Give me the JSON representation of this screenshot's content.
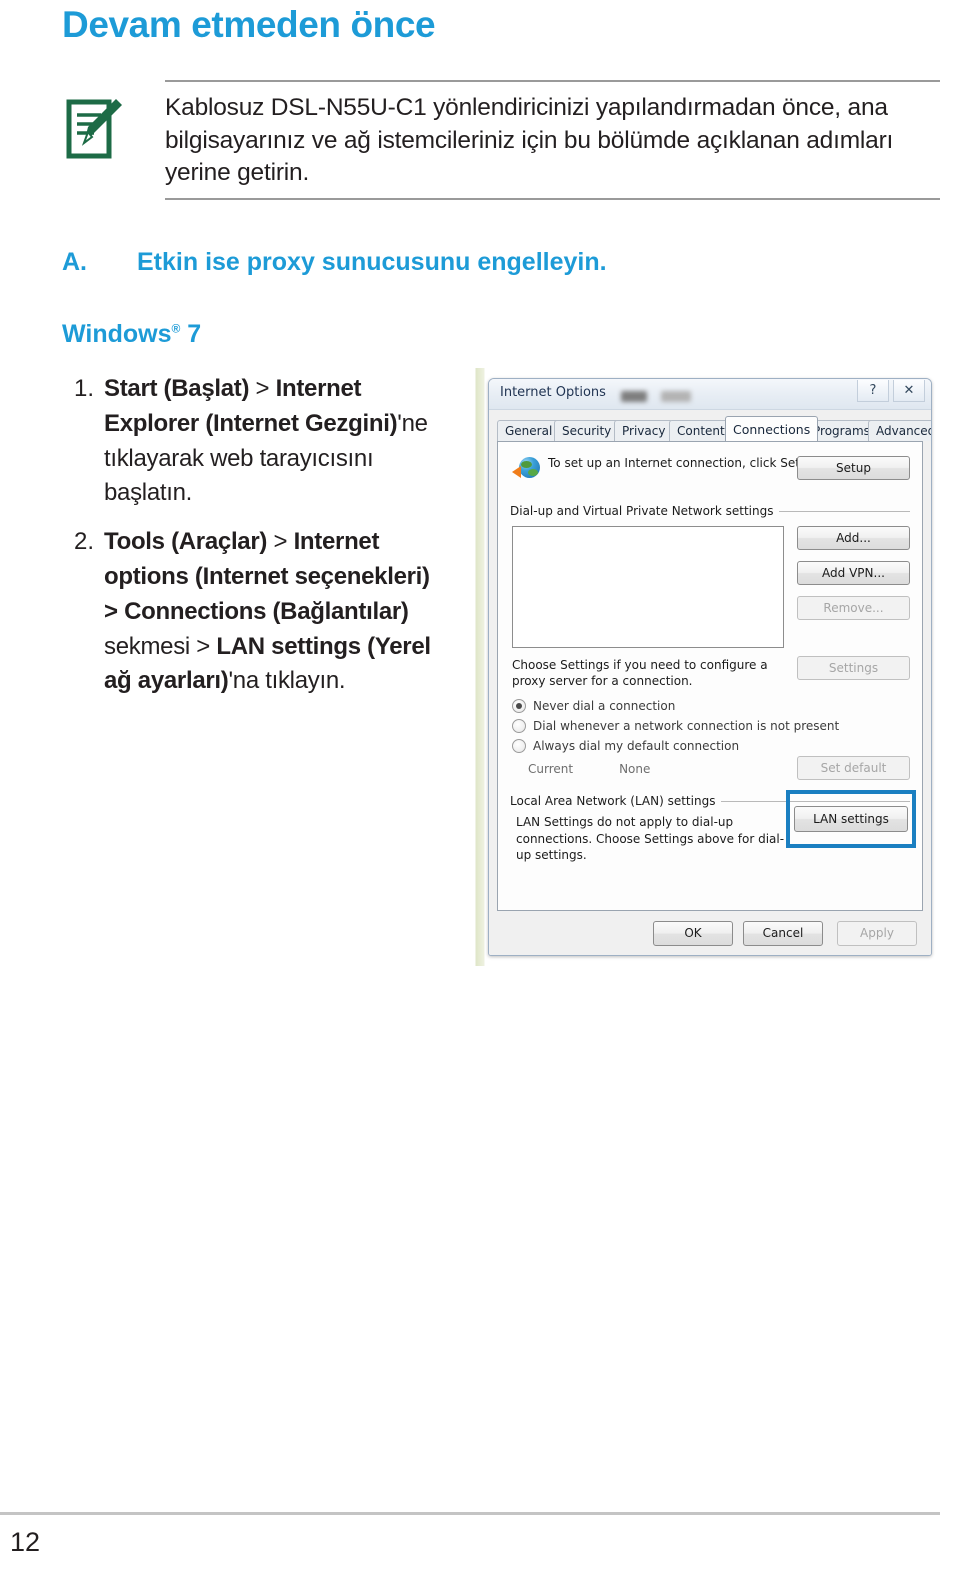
{
  "page": {
    "title": "Devam etmeden önce",
    "number": "12"
  },
  "note": {
    "icon": "note-pencil-icon",
    "text": "Kablosuz DSL-N55U-C1 yönlendiricinizi yapılandırmadan önce, ana bilgisayarınız ve ağ istemcileriniz için bu bölümde açıklanan adımları yerine getirin."
  },
  "section": {
    "letter": "A.",
    "heading": "Etkin ise proxy sunucusunu engelleyin.",
    "os_label": "Windows",
    "os_sup": "®",
    "os_version": "7"
  },
  "steps": [
    {
      "num": "1.",
      "parts": [
        {
          "text": "Start (Başlat) ",
          "bold": true
        },
        {
          "text": "> ",
          "bold": false
        },
        {
          "text": "Internet Explorer (Internet Gezgini)",
          "bold": true
        },
        {
          "text": "'ne tıklayarak web tarayıcısını başlatın.",
          "bold": false
        }
      ]
    },
    {
      "num": "2.",
      "parts": [
        {
          "text": "Tools (Araçlar) ",
          "bold": true
        },
        {
          "text": "> ",
          "bold": false
        },
        {
          "text": "Internet options (Internet seçenekleri) > Connections (Bağlantılar) ",
          "bold": true
        },
        {
          "text": "sekmesi > ",
          "bold": false
        },
        {
          "text": "LAN settings (Yerel ağ ayarları)",
          "bold": true
        },
        {
          "text": "'na tıklayın.",
          "bold": false
        }
      ]
    }
  ],
  "dialog": {
    "title": "Internet Options",
    "help_icon": "?",
    "close_icon": "✕",
    "tabs": [
      {
        "label": "General",
        "active": false
      },
      {
        "label": "Security",
        "active": false
      },
      {
        "label": "Privacy",
        "active": false
      },
      {
        "label": "Content",
        "active": false
      },
      {
        "label": "Connections",
        "active": true
      },
      {
        "label": "Programs",
        "active": false
      },
      {
        "label": "Advanced",
        "active": false
      }
    ],
    "setup": {
      "text": "To set up an Internet connection, click Setup.",
      "button": "Setup",
      "icon": "globe-icon"
    },
    "dialup": {
      "group_title": "Dial-up and Virtual Private Network settings",
      "buttons": [
        {
          "label": "Add...",
          "disabled": false
        },
        {
          "label": "Add VPN...",
          "disabled": false
        },
        {
          "label": "Remove...",
          "disabled": true
        }
      ],
      "proxy_note": "Choose Settings if you need to configure a proxy server for a connection.",
      "settings_button": {
        "label": "Settings",
        "disabled": true
      },
      "radios": [
        {
          "label": "Never dial a connection",
          "selected": true
        },
        {
          "label": "Dial whenever a network connection is not present",
          "selected": false
        },
        {
          "label": "Always dial my default connection",
          "selected": false
        }
      ],
      "current_label": "Current",
      "current_value": "None",
      "set_default_button": {
        "label": "Set default",
        "disabled": true
      }
    },
    "lan": {
      "group_title": "Local Area Network (LAN) settings",
      "note": "LAN Settings do not apply to dial-up connections. Choose Settings above for dial-up settings.",
      "button": "LAN settings",
      "highlight_color": "#1b7fc1"
    },
    "footer": {
      "ok": "OK",
      "cancel": "Cancel",
      "apply": "Apply"
    }
  },
  "colors": {
    "accent_blue": "#1d9bd7",
    "note_green": "#1d6b46",
    "text": "#231f20"
  }
}
